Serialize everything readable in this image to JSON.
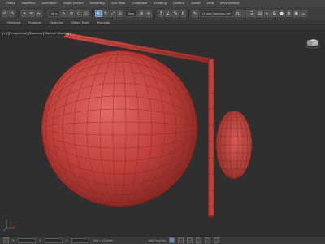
{
  "menubar": {
    "items": [
      "Create",
      "Modifiers",
      "Animation",
      "Graph Editors",
      "Rendering",
      "Civil View",
      "Customize",
      "Scripting",
      "Content",
      "Arnold",
      "Help",
      "MASHGRAND"
    ]
  },
  "toolbar": {
    "view_dropdown": "View",
    "selection_set_dropdown": "Create Selection Set"
  },
  "ribbon": {
    "tabs": [
      "Modeling",
      "Freeform",
      "Selection",
      "Object Paint",
      "Populate"
    ]
  },
  "viewport": {
    "label": "[+] [Perspective] [Standard] [Default Shading]",
    "object_color": "#c0403a",
    "grid_color": "#7a1f1c"
  },
  "statusbar": {
    "x_label": "X:",
    "y_label": "Y:",
    "z_label": "Z:",
    "grid_text": "Grid = 10.0mm",
    "add_time_tag": "Add Time Tag",
    "auto_key": "Auto Key"
  },
  "icons": {
    "viewcube": "viewcube-icon",
    "navigation": [
      "zoom-icon",
      "pan-icon",
      "orbit-icon",
      "maximize-icon"
    ]
  }
}
